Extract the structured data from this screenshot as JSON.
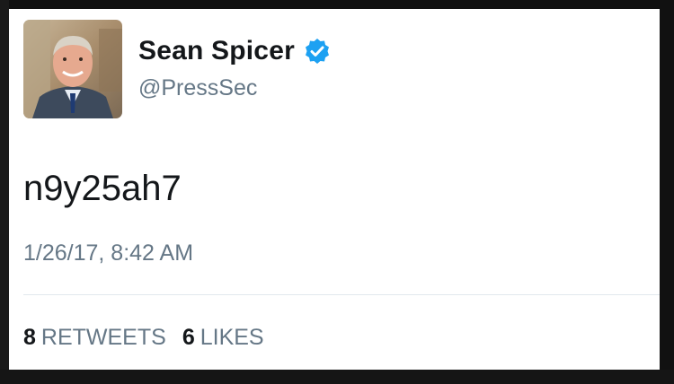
{
  "tweet": {
    "author_name": "Sean Spicer",
    "handle": "@PressSec",
    "verified": true,
    "text": "n9y25ah7",
    "timestamp": "1/26/17, 8:42 AM",
    "retweets_count": "8",
    "retweets_label": "RETWEETS",
    "likes_count": "6",
    "likes_label": "LIKES"
  },
  "colors": {
    "verified_badge": "#1da1f2",
    "secondary_text": "#657786",
    "primary_text": "#14171a"
  },
  "icons": {
    "verified": "verified-badge-icon",
    "avatar": "profile-photo"
  }
}
